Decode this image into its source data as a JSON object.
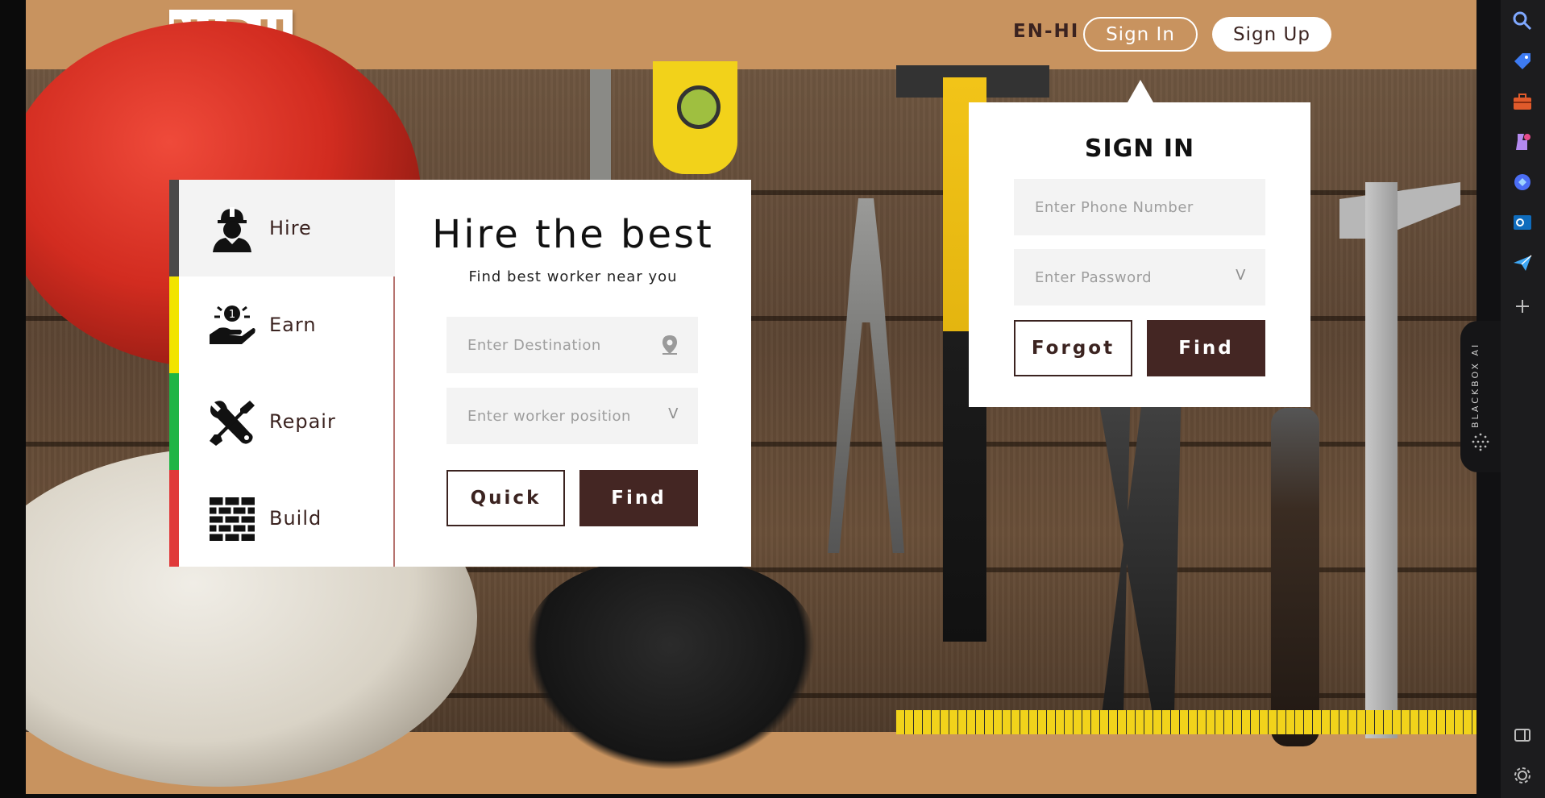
{
  "brand": {
    "logo_text": "NIDU"
  },
  "header": {
    "language_toggle": "EN-HI",
    "sign_in_label": "Sign In",
    "sign_up_label": "Sign Up"
  },
  "categories": [
    {
      "label": "Hire",
      "icon": "worker-helmet-icon",
      "color": "#4a4a4a",
      "active": true
    },
    {
      "label": "Earn",
      "icon": "coin-hand-icon",
      "color": "#f2e400",
      "active": false
    },
    {
      "label": "Repair",
      "icon": "wrench-screwdriver-icon",
      "color": "#1fb545",
      "active": false
    },
    {
      "label": "Build",
      "icon": "brick-wall-icon",
      "color": "#e03a3a",
      "active": false
    }
  ],
  "hire_card": {
    "title": "Hire the best",
    "subtitle": "Find best worker near you",
    "destination_placeholder": "Enter Destination",
    "position_placeholder": "Enter worker position",
    "dropdown_marker": "V",
    "quick_label": "Quick",
    "find_label": "Find"
  },
  "signin_popup": {
    "title": "SIGN IN",
    "phone_placeholder": "Enter Phone Number",
    "password_placeholder": "Enter Password",
    "password_marker": "V",
    "forgot_label": "Forgot",
    "find_label": "Find"
  },
  "extension_tab": {
    "label": "BLACKBOX AI"
  },
  "colors": {
    "brand_tan": "#c8935f",
    "dark_brown": "#442623",
    "text_brown": "#3b2320"
  }
}
